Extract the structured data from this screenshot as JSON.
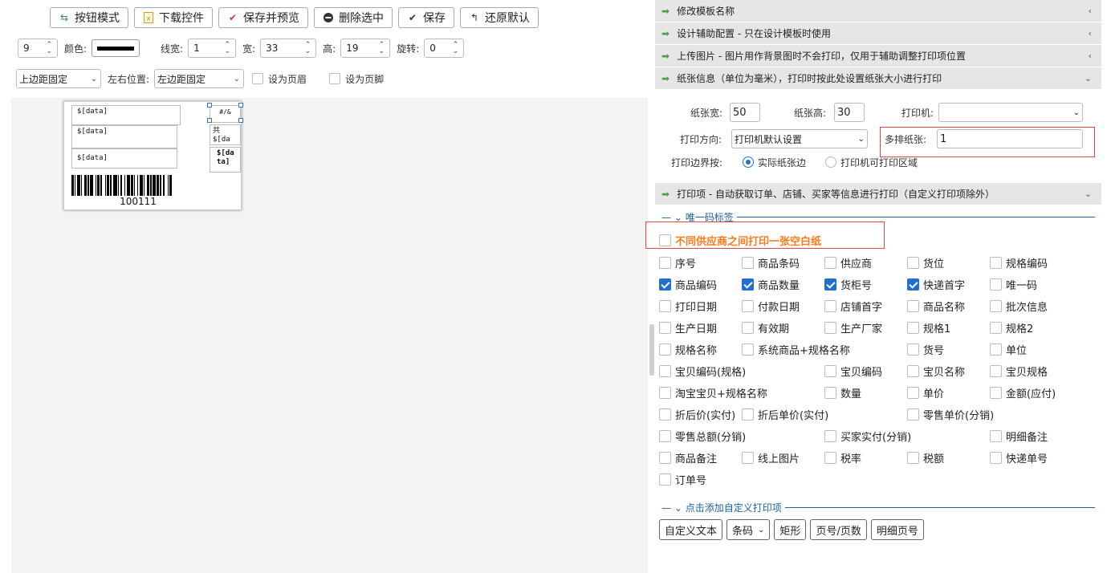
{
  "toolbar": {
    "button_mode": "按钮模式",
    "download_control": "下载控件",
    "save_preview": "保存并预览",
    "delete_selected": "删除选中",
    "save": "保存",
    "restore_default": "还原默认"
  },
  "props": {
    "font_size_value": "9",
    "color_label": "颜色:",
    "line_width_label": "线宽:",
    "line_width_value": "1",
    "width_label": "宽:",
    "width_value": "33",
    "height_label": "高:",
    "height_value": "19",
    "rotate_label": "旋转:",
    "rotate_value": "0",
    "top_align_value": "上边距固定",
    "lr_pos_label": "左右位置:",
    "lr_pos_value": "左边距固定",
    "set_header": "设为页眉",
    "set_footer": "设为页脚",
    "line_color": "#000000"
  },
  "label": {
    "field1": "$[data]",
    "field2": "$[data]",
    "field3": "$[data]",
    "page_field": "#/&",
    "total_field": "共\n$[da",
    "selected_field": "$[da\nta]",
    "barcode_number": "100111"
  },
  "accordion": {
    "rename_template": "修改模板名称",
    "design_aid": "设计辅助配置 - 只在设计模板时使用",
    "upload_image": "上传图片 - 图片用作背景图时不会打印，仅用于辅助调整打印项位置",
    "paper_info": "纸张信息（单位为毫米），打印时按此处设置纸张大小进行打印",
    "print_items": "打印项 - 自动获取订单、店铺、买家等信息进行打印（自定义打印项除外）"
  },
  "paper": {
    "width_label": "纸张宽:",
    "width_value": "50",
    "height_label": "纸张高:",
    "height_value": "30",
    "printer_label": "打印机:",
    "printer_value": "",
    "direction_label": "打印方向:",
    "direction_value": "打印机默认设置",
    "multi_row_label": "多排纸张:",
    "multi_row_value": "1",
    "boundary_label": "打印边界按:",
    "boundary_opt1": "实际纸张边",
    "boundary_opt2": "打印机可打印区域"
  },
  "print_items": {
    "group_title": "唯一码标签",
    "special_option": "不同供应商之间打印一张空白纸",
    "items": [
      {
        "label": "序号",
        "checked": false
      },
      {
        "label": "商品条码",
        "checked": false
      },
      {
        "label": "供应商",
        "checked": false
      },
      {
        "label": "货位",
        "checked": false
      },
      {
        "label": "规格编码",
        "checked": false
      },
      {
        "label": "商品编码",
        "checked": true
      },
      {
        "label": "商品数量",
        "checked": true
      },
      {
        "label": "货柜号",
        "checked": true
      },
      {
        "label": "快递首字",
        "checked": true
      },
      {
        "label": "唯一码",
        "checked": false
      },
      {
        "label": "打印日期",
        "checked": false
      },
      {
        "label": "付款日期",
        "checked": false
      },
      {
        "label": "店铺首字",
        "checked": false
      },
      {
        "label": "商品名称",
        "checked": false
      },
      {
        "label": "批次信息",
        "checked": false
      },
      {
        "label": "生产日期",
        "checked": false
      },
      {
        "label": "有效期",
        "checked": false
      },
      {
        "label": "生产厂家",
        "checked": false
      },
      {
        "label": "规格1",
        "checked": false
      },
      {
        "label": "规格2",
        "checked": false
      },
      {
        "label": "规格名称",
        "checked": false
      },
      {
        "label": "系统商品+规格名称",
        "checked": false
      },
      {
        "label": "货号",
        "checked": false
      },
      {
        "label": "单位",
        "checked": false
      },
      {
        "label": "宝贝编码(规格)",
        "checked": false
      },
      {
        "label": "宝贝编码",
        "checked": false
      },
      {
        "label": "宝贝名称",
        "checked": false
      },
      {
        "label": "宝贝规格",
        "checked": false
      },
      {
        "label": "淘宝宝贝+规格名称",
        "checked": false
      },
      {
        "label": "数量",
        "checked": false
      },
      {
        "label": "单价",
        "checked": false
      },
      {
        "label": "金额(应付)",
        "checked": false
      },
      {
        "label": "折后价(实付)",
        "checked": false
      },
      {
        "label": "折后单价(实付)",
        "checked": false
      },
      {
        "label": "零售单价(分销)",
        "checked": false
      },
      {
        "label": "零售总额(分销)",
        "checked": false
      },
      {
        "label": "买家实付(分销)",
        "checked": false
      },
      {
        "label": "明细备注",
        "checked": false
      },
      {
        "label": "商品备注",
        "checked": false
      },
      {
        "label": "线上图片",
        "checked": false
      },
      {
        "label": "税率",
        "checked": false
      },
      {
        "label": "税额",
        "checked": false
      },
      {
        "label": "快递单号",
        "checked": false
      },
      {
        "label": "订单号",
        "checked": false
      }
    ],
    "custom_group_title": "点击添加自定义打印项",
    "custom_buttons": {
      "custom_text": "自定义文本",
      "barcode": "条码",
      "rect": "矩形",
      "page_number": "页号/页数",
      "detail_page": "明细页号"
    }
  }
}
